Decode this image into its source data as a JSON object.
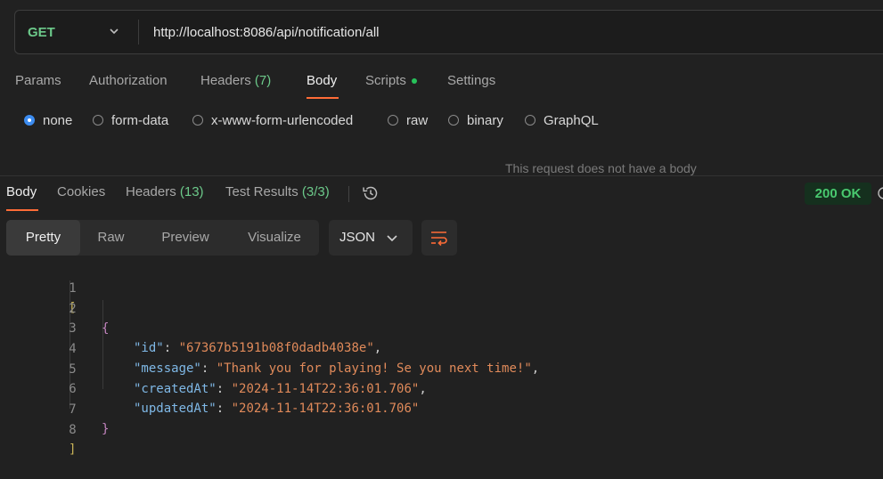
{
  "request": {
    "method": "GET",
    "url": "http://localhost:8086/api/notification/all"
  },
  "request_tabs": [
    {
      "label": "Params"
    },
    {
      "label": "Authorization"
    },
    {
      "label": "Headers",
      "count": "(7)"
    },
    {
      "label": "Body"
    },
    {
      "label": "Scripts"
    },
    {
      "label": "Settings"
    }
  ],
  "body_types": [
    {
      "label": "none",
      "checked": true
    },
    {
      "label": "form-data"
    },
    {
      "label": "x-www-form-urlencoded"
    },
    {
      "label": "raw"
    },
    {
      "label": "binary"
    },
    {
      "label": "GraphQL"
    }
  ],
  "no_body_message": "This request does not have a body",
  "response_tabs": [
    {
      "label": "Body"
    },
    {
      "label": "Cookies"
    },
    {
      "label": "Headers",
      "count": "(13)"
    },
    {
      "label": "Test Results",
      "count": "(3/3)"
    }
  ],
  "status": "200 OK",
  "view_modes": [
    "Pretty",
    "Raw",
    "Preview",
    "Visualize"
  ],
  "format": "JSON",
  "icons": [
    "chevron-down-icon",
    "history-icon",
    "wrap-lines-icon"
  ],
  "colors": {
    "accent": "#ff6c37",
    "success": "#49c96f"
  },
  "response_json": {
    "id": "67367b5191b08f0dadb4038e",
    "message": "Thank you for playing! Se you next time!",
    "createdAt": "2024-11-14T22:36:01.706",
    "updatedAt": "2024-11-14T22:36:01.706"
  },
  "line_numbers": [
    "1",
    "2",
    "3",
    "4",
    "5",
    "6",
    "7",
    "8"
  ]
}
